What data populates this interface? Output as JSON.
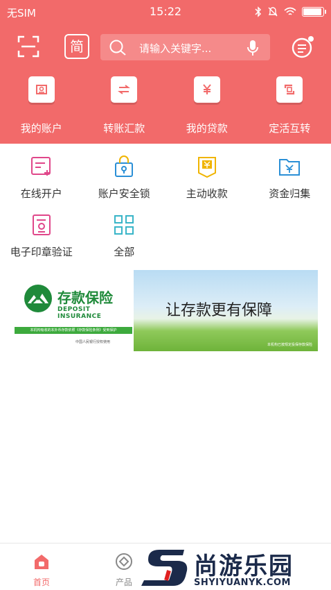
{
  "status_bar": {
    "carrier": "无SIM",
    "time": "15:22",
    "battery_level": 0.95
  },
  "header": {
    "simplified_label": "简",
    "search_placeholder": "请输入关键字..."
  },
  "quick_actions": [
    {
      "label": "我的账户",
      "icon": "account-card-icon"
    },
    {
      "label": "转账汇款",
      "icon": "transfer-icon"
    },
    {
      "label": "我的贷款",
      "icon": "loan-yen-icon"
    },
    {
      "label": "定活互转",
      "icon": "exchange-icon"
    }
  ],
  "grid_items": [
    {
      "label": "在线开户",
      "icon": "open-account-icon",
      "color": "#e0478a"
    },
    {
      "label": "账户安全锁",
      "icon": "lock-icon",
      "color": "#2a8fd6"
    },
    {
      "label": "主动收款",
      "icon": "receive-yen-icon",
      "color": "#f0b400"
    },
    {
      "label": "资金归集",
      "icon": "folder-yen-icon",
      "color": "#2a8fd6"
    },
    {
      "label": "电子印章验证",
      "icon": "seal-icon",
      "color": "#e0478a"
    },
    {
      "label": "全部",
      "icon": "all-grid-icon",
      "color": "#39b5c8"
    }
  ],
  "banner": {
    "title": "存款保险",
    "subtitle": "DEPOSIT INSURANCE",
    "strip_text": "本机构吸收的本外币存款依照《存款保险条例》受到保护",
    "footnote": "中国人民银行授权使用",
    "slogan": "让存款更有保障",
    "right_footnote": "本机构已按规定投保存款保险"
  },
  "tabs": [
    {
      "label": "首页",
      "icon": "home-icon",
      "active": true
    },
    {
      "label": "产品",
      "icon": "product-icon",
      "active": false
    }
  ],
  "watermark": {
    "name": "尚游乐园",
    "url": "SHYIYUANYK.COM"
  },
  "colors": {
    "brand_red": "#f26a6a",
    "text": "#333333",
    "tab_inactive": "#888888"
  }
}
